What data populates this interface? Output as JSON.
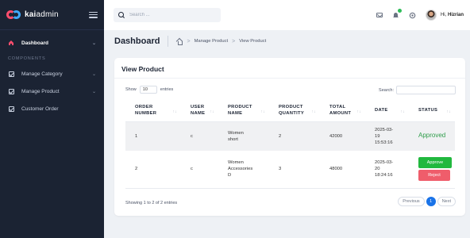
{
  "brand": {
    "name_bold": "kai",
    "name_rest": "admin"
  },
  "search": {
    "placeholder": "Search ..."
  },
  "user": {
    "greeting": "Hi,",
    "name": "Hizrian"
  },
  "sidebar": {
    "items": [
      {
        "label": "Dashboard",
        "icon": "home-icon",
        "caret": "⌄"
      }
    ],
    "section": "COMPONENTS",
    "components": [
      {
        "label": "Manage Category",
        "icon": "check-square-icon",
        "caret": "⌄"
      },
      {
        "label": "Manage Product",
        "icon": "check-square-icon",
        "caret": "⌄"
      },
      {
        "label": "Customer Order",
        "icon": "check-square-icon"
      }
    ]
  },
  "page": {
    "title": "Dashboard",
    "breadcrumb": [
      "Manage Product",
      "View Product"
    ],
    "crumb_sep": ">"
  },
  "card": {
    "title": "View Product",
    "show_label": "Show",
    "page_length": "10",
    "entries_label": "entries",
    "search_label": "Search:",
    "info": "Showing 1 to 2 of 2 entries",
    "pager": {
      "previous": "Previous",
      "current": "1",
      "next": "Next"
    }
  },
  "table": {
    "columns": [
      [
        "ORDER",
        "NUMBER"
      ],
      [
        "USER",
        "NAME"
      ],
      [
        "PRODUCT",
        "NAME"
      ],
      [
        "PRODUCT",
        "QUANTITY"
      ],
      [
        "TOTAL",
        "AMOUNT"
      ],
      [
        "DATE",
        ""
      ],
      [
        "STATUS",
        ""
      ]
    ],
    "rows": [
      {
        "order": "1",
        "user": "c",
        "product": [
          "Women",
          "short"
        ],
        "qty": "2",
        "amount": "42000",
        "date": [
          "2025-03-",
          "19",
          "15:53:16"
        ],
        "status": "Approved"
      },
      {
        "order": "2",
        "user": "c",
        "product": [
          "Women",
          "Accessories",
          "D"
        ],
        "qty": "3",
        "amount": "48000",
        "date": [
          "2025-03-",
          "20",
          "18:24:16"
        ],
        "actions": {
          "approve": "Approve",
          "reject": "Reject"
        }
      }
    ]
  },
  "colors": {
    "sidebar_bg": "#1b2333",
    "approved": "#2e9d4a",
    "approve_btn": "#21b83e",
    "reject_btn": "#ef5d6b",
    "page_active": "#1a73e8",
    "notify_badge": "#2ebd59"
  }
}
